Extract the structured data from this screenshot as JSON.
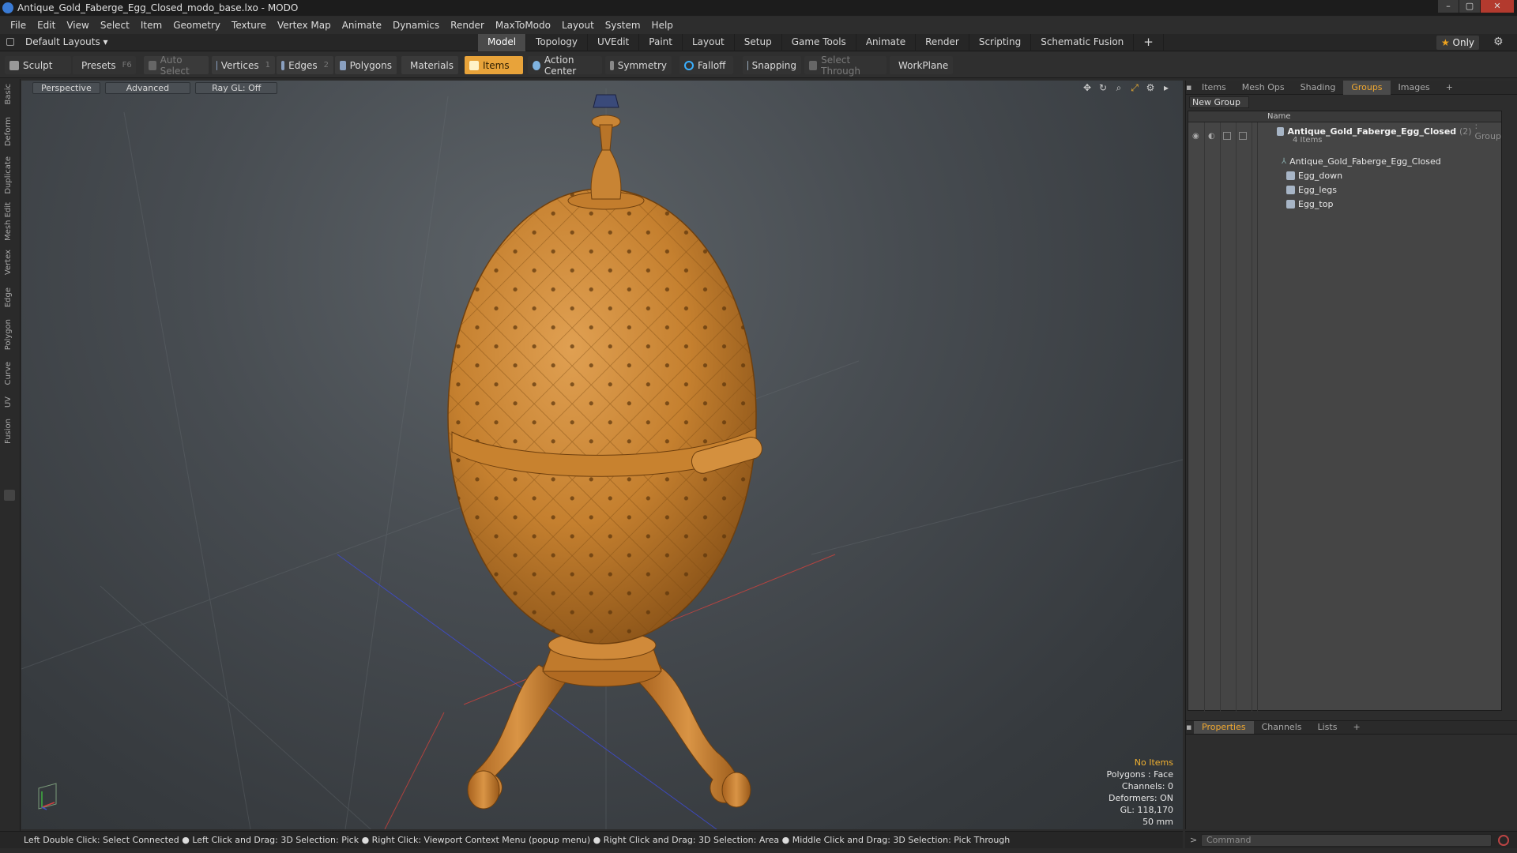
{
  "window": {
    "title": "Antique_Gold_Faberge_Egg_Closed_modo_base.lxo - MODO",
    "controls": [
      "–",
      "▢",
      "✕"
    ]
  },
  "menu": [
    "File",
    "Edit",
    "View",
    "Select",
    "Item",
    "Geometry",
    "Texture",
    "Vertex Map",
    "Animate",
    "Dynamics",
    "Render",
    "MaxToModo",
    "Layout",
    "System",
    "Help"
  ],
  "layout_bar": {
    "default_layouts": "Default Layouts ▾",
    "tabs": [
      "Model",
      "Topology",
      "UVEdit",
      "Paint",
      "Layout",
      "Setup",
      "Game Tools",
      "Animate",
      "Render",
      "Scripting",
      "Schematic Fusion",
      "+"
    ],
    "active_tab": "Model",
    "only_label": "Only"
  },
  "toolbar": {
    "sculpt": "Sculpt",
    "presets": "Presets",
    "presets_key": "F6",
    "auto_select": "Auto Select",
    "vertices": "Vertices",
    "vertices_key": "1",
    "edges": "Edges",
    "edges_key": "2",
    "polygons": "Polygons",
    "materials": "Materials",
    "items": "Items",
    "action_center": "Action Center",
    "symmetry": "Symmetry",
    "falloff": "Falloff",
    "snapping": "Snapping",
    "select_through": "Select Through",
    "workplane": "WorkPlane"
  },
  "left_tabs": [
    "Basic",
    "Deform",
    "Duplicate",
    "Mesh Edit",
    "Vertex",
    "Edge",
    "Polygon",
    "Curve",
    "UV",
    "Fusion"
  ],
  "viewport": {
    "view_mode": "Perspective",
    "shading": "Advanced",
    "raygl": "Ray GL: Off",
    "info": {
      "selection": "No Items",
      "polygons": "Polygons : Face",
      "channels": "Channels: 0",
      "deformers": "Deformers: ON",
      "gl": "GL: 118,170",
      "focal": "50 mm"
    }
  },
  "status_bar": "Left Double Click: Select Connected ● Left Click and Drag: 3D Selection: Pick ● Right Click: Viewport Context Menu (popup menu) ● Right Click and Drag: 3D Selection: Area ● Middle Click and Drag: 3D Selection: Pick Through",
  "right_panel": {
    "tabs": [
      "Items",
      "Mesh Ops",
      "Shading",
      "Groups",
      "Images",
      "+"
    ],
    "active_tab": "Groups",
    "new_group": "New Group",
    "column_name": "Name",
    "group": {
      "name": "Antique_Gold_Faberge_Egg_Closed",
      "count": "(2)",
      "type": ": Group",
      "sub": "4 Items"
    },
    "children": [
      "Antique_Gold_Faberge_Egg_Closed",
      "Egg_down",
      "Egg_legs",
      "Egg_top"
    ],
    "bottom_tabs": [
      "Properties",
      "Channels",
      "Lists",
      "+"
    ],
    "bottom_active": "Properties",
    "command_placeholder": "Command"
  },
  "colors": {
    "accent": "#f0a830",
    "items_active": "#e8a33a",
    "egg": "#c9802f"
  }
}
